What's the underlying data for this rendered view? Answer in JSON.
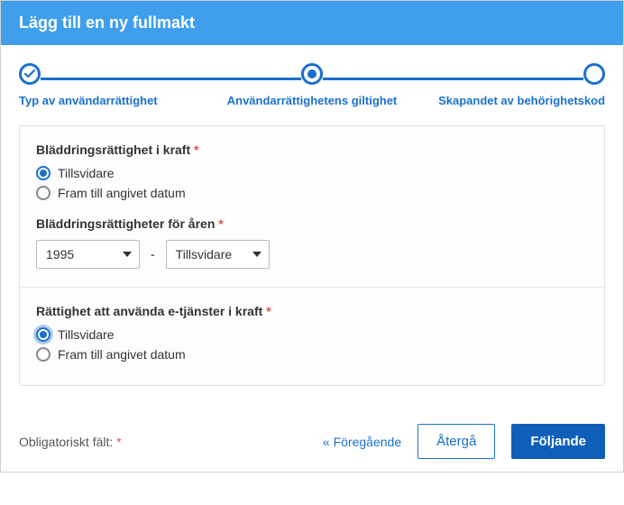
{
  "header": {
    "title": "Lägg till en ny fullmakt"
  },
  "stepper": {
    "steps": [
      {
        "label": "Typ av användarrättighet"
      },
      {
        "label": "Användarrättighetens giltighet"
      },
      {
        "label": "Skapandet av behörighetskod"
      }
    ]
  },
  "sections": {
    "browse_validity": {
      "title": "Bläddringsrättighet i kraft",
      "options": {
        "until_further": "Tillsvidare",
        "until_date": "Fram till angivet datum"
      }
    },
    "browse_years": {
      "title": "Bläddringsrättigheter för åren",
      "from_year": "1995",
      "to_value": "Tillsvidare",
      "separator": "-"
    },
    "eservices_validity": {
      "title": "Rättighet att använda e-tjänster i kraft",
      "options": {
        "until_further": "Tillsvidare",
        "until_date": "Fram till angivet datum"
      }
    }
  },
  "footer": {
    "mandatory_label": "Obligatoriskt fält:",
    "previous_label": "Föregående",
    "cancel_label": "Återgå",
    "next_label": "Följande"
  },
  "icons": {
    "required_mark": "*",
    "chevrons_left": "«"
  }
}
